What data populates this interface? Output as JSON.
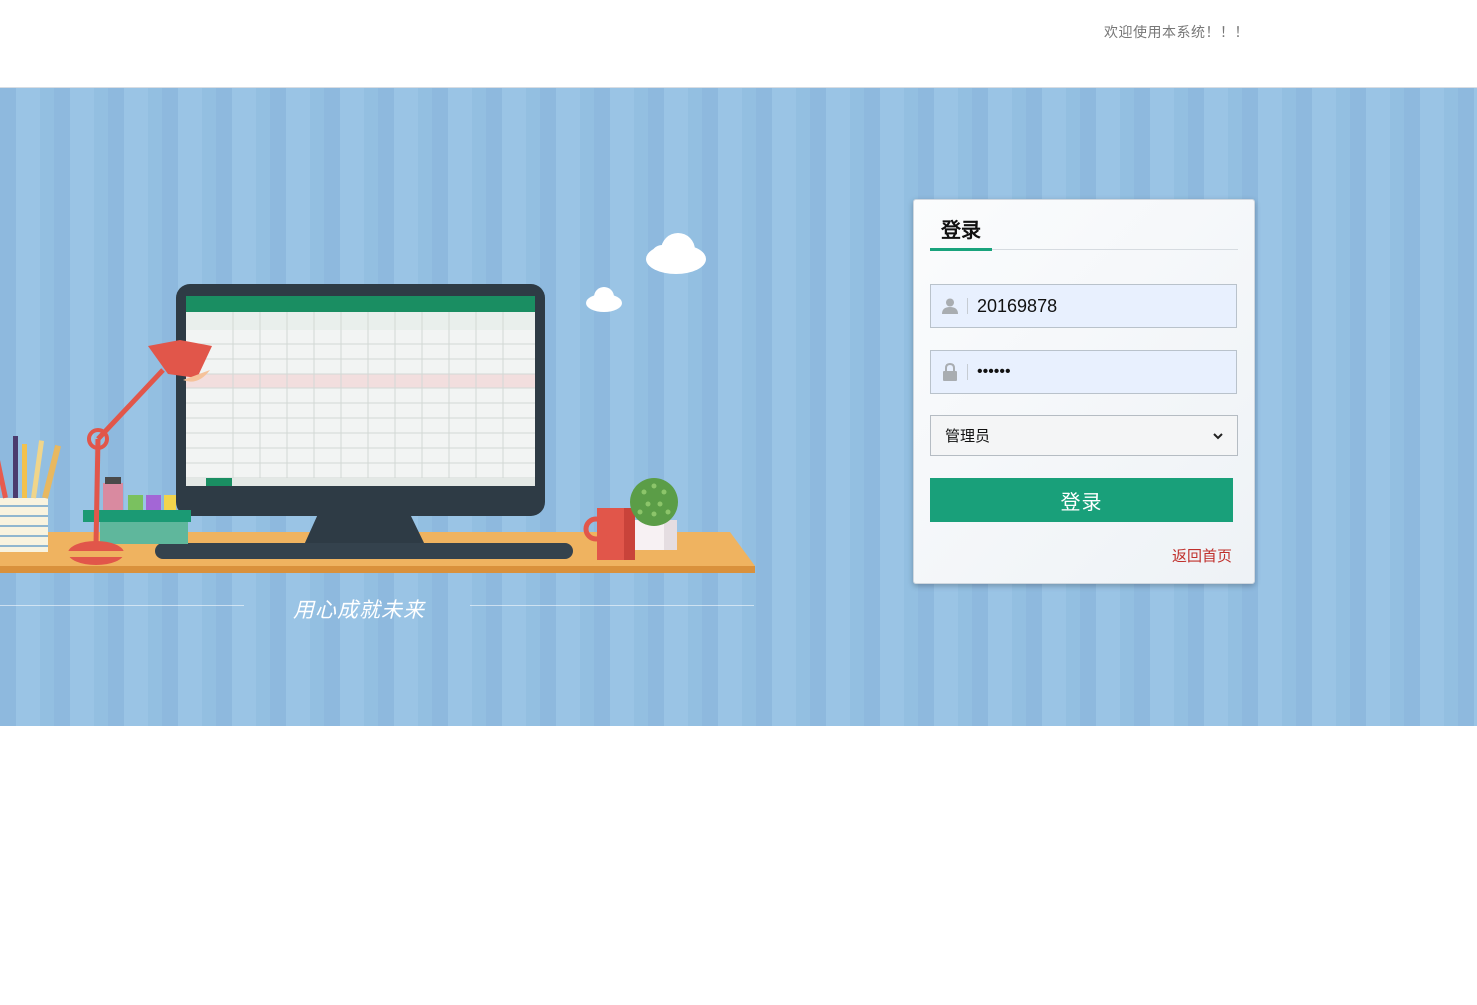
{
  "header": {
    "welcome_text": "欢迎使用本系统！！！"
  },
  "banner": {
    "slogan": "用心成就未来",
    "background_color": "#93bfe1"
  },
  "login": {
    "title": "登录",
    "username": {
      "value": "20169878",
      "icon": "user-icon"
    },
    "password": {
      "value": "••••••",
      "icon": "lock-icon"
    },
    "role_select": {
      "selected": "管理员",
      "options": [
        "管理员"
      ]
    },
    "submit_label": "登录",
    "back_home_label": "返回首页",
    "accent_color": "#19a07a",
    "link_color": "#c0302c"
  }
}
